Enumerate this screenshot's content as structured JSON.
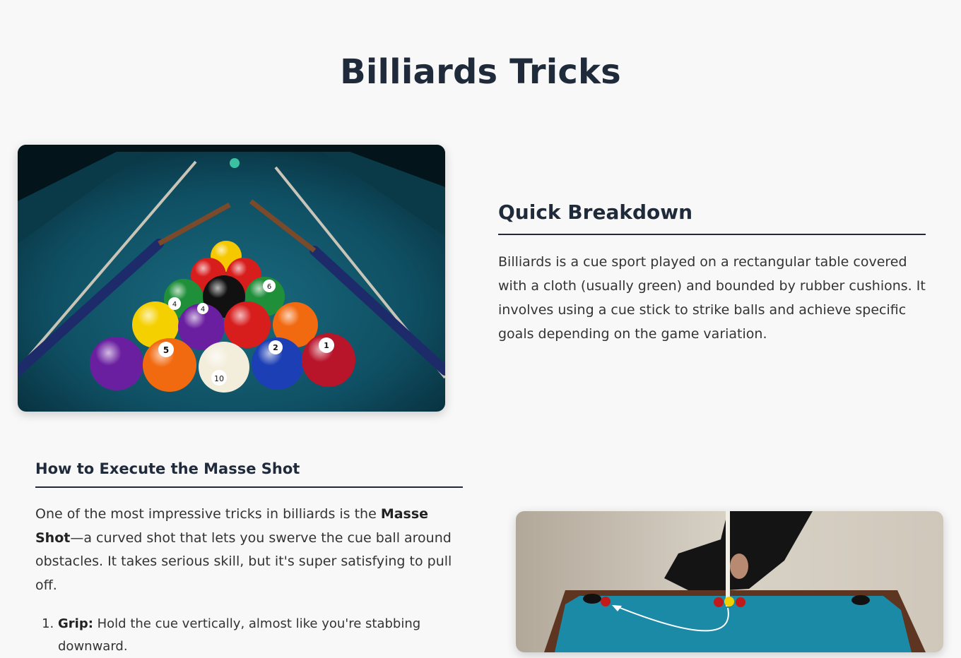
{
  "page": {
    "title": "Billiards Tricks"
  },
  "quick_breakdown": {
    "heading": "Quick Breakdown",
    "body": "Billiards is a cue sport played on a rectangular table covered with a cloth (usually green) and bounded by rubber cushions. It involves using a cue stick to strike balls and achieve specific goals depending on the game variation."
  },
  "masse_shot": {
    "heading": "How to Execute the Masse Shot",
    "intro_before": "One of the most impressive tricks in billiards is the ",
    "intro_bold": "Masse Shot",
    "intro_after": "—a curved shot that lets you swerve the cue ball around obstacles. It takes serious skill, but it's super satisfying to pull off.",
    "steps": [
      {
        "title": "Grip:",
        "text": " Hold the cue vertically, almost like you're stabbing downward."
      }
    ]
  },
  "images": {
    "rack_ball_numbers": [
      "4",
      "4",
      "6",
      "5",
      "10",
      "2",
      "1"
    ]
  },
  "colors": {
    "heading": "#1f2a3a",
    "background": "#f8f8f8",
    "felt": "#0f4f63"
  }
}
